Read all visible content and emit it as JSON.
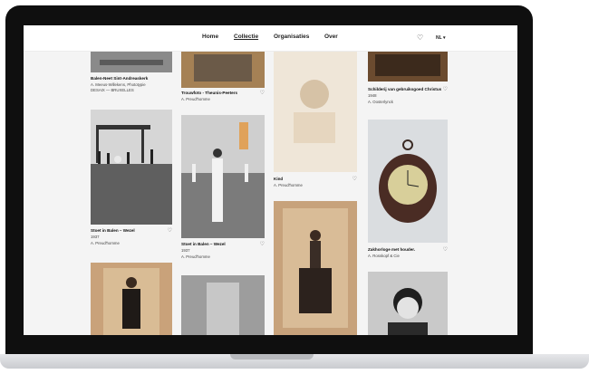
{
  "nav": {
    "links": [
      "Home",
      "Collectie",
      "Organisaties",
      "Over"
    ],
    "language": "NL ▾",
    "heart_icon": "heart-icon"
  },
  "items": [
    {
      "title": "Balen-Neet Sint-Andreaskerk",
      "lines": [
        "A. Meeus-Willekens, Phototypie",
        "DESAIX — BRUXELLES"
      ]
    },
    {
      "title": "Trouwfoto - Theunis-Peeters",
      "lines": [
        "A. Preud'homme"
      ]
    },
    {
      "title": "Kind",
      "lines": [
        "A. Preud'homme"
      ]
    },
    {
      "title": "Schilderij van gebruiksgoed Christus",
      "lines": [
        "1948",
        "A. Oosterlynck"
      ]
    },
    {
      "title": "Stoet in Balen – Wezel",
      "lines": [
        "1937",
        "A. Preud'homme"
      ]
    },
    {
      "title": "Stoet in Balen – Wezel",
      "lines": [
        "1937",
        "A. Preud'homme"
      ]
    },
    {
      "title": "Zakhorloge met houder.",
      "lines": [
        "A. Rosskopf & Cie"
      ]
    }
  ],
  "colors": {
    "sepia": "#c9a27a",
    "page_bg": "#f4f4f4",
    "bezel": "#0f0f0f"
  }
}
